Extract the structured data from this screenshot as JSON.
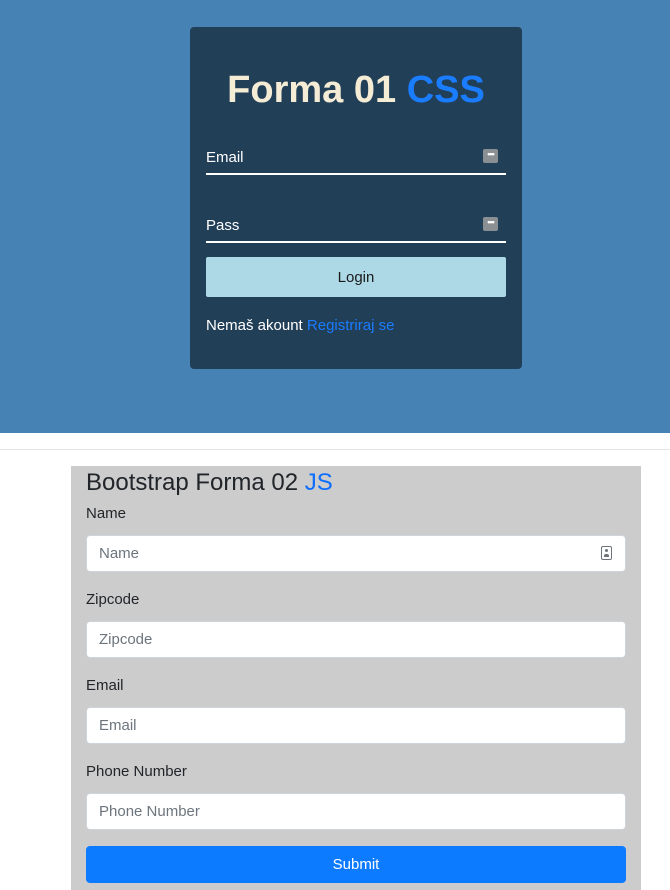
{
  "form1": {
    "title_main": "Forma 01",
    "title_accent": "CSS",
    "email_label": "Email",
    "pass_label": "Pass",
    "field_icon": "ellipsis-icon",
    "login_label": "Login",
    "register_prompt": "Nemaš akount",
    "register_link": "Registriraj se",
    "colors": {
      "background": "#4682b4",
      "card": "#223f58",
      "accent": "#1a7cff",
      "button": "#add8e6"
    }
  },
  "form2": {
    "title_main": "Bootstrap Forma 02",
    "title_accent": "JS",
    "fields": [
      {
        "label": "Name",
        "placeholder": "Name",
        "value": ""
      },
      {
        "label": "Zipcode",
        "placeholder": "Zipcode",
        "value": ""
      },
      {
        "label": "Email",
        "placeholder": "Email",
        "value": ""
      },
      {
        "label": "Phone Number",
        "placeholder": "Phone Number",
        "value": ""
      }
    ],
    "name_icon": "contact-card-icon",
    "submit_label": "Submit",
    "colors": {
      "panel": "#cccccc",
      "accent": "#0d6efd",
      "submit": "#0d7bff"
    }
  }
}
